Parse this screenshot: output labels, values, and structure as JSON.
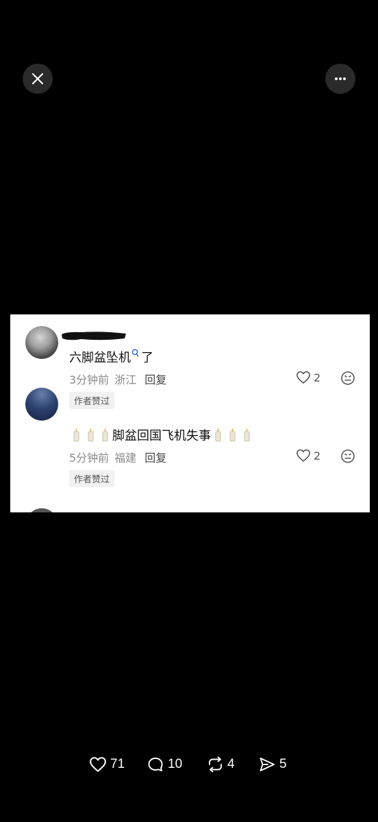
{
  "viewer": {
    "close_icon": "close-icon",
    "more_icon": "more-icon"
  },
  "comments": [
    {
      "username": "",
      "text_a": "六脚盆坠机",
      "text_b": "了",
      "time": "3分钟前",
      "location": "浙江",
      "reply_label": "回复",
      "likes": "2",
      "author_badge": "作者赞过"
    },
    {
      "text": "脚盆回国飞机失事",
      "time": "5分钟前",
      "location": "福建",
      "reply_label": "回复",
      "likes": "2",
      "author_badge": "作者赞过"
    }
  ],
  "actions": {
    "likes": "71",
    "comments": "10",
    "reposts": "4",
    "shares": "5"
  },
  "colors": {
    "background": "#000000",
    "card": "#ffffff",
    "meta_text": "#8a8a8a",
    "button_bg": "#2a2a2a"
  }
}
